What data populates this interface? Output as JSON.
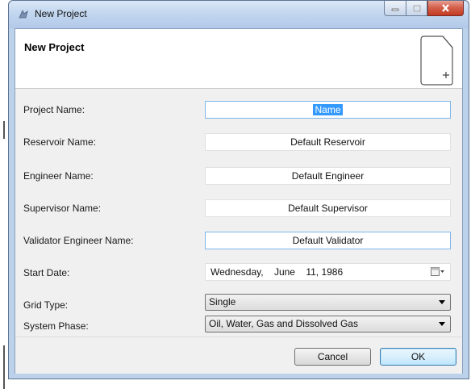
{
  "window": {
    "title": "New Project"
  },
  "header": {
    "title": "New Project"
  },
  "form": {
    "project_name": {
      "label": "Project Name:",
      "value": "Name"
    },
    "reservoir_name": {
      "label": "Reservoir Name:",
      "value": "Default Reservoir"
    },
    "engineer_name": {
      "label": "Engineer Name:",
      "value": "Default Engineer"
    },
    "supervisor_name": {
      "label": "Supervisor Name:",
      "value": "Default Supervisor"
    },
    "validator_name": {
      "label": "Validator Engineer Name:",
      "value": "Default Validator"
    },
    "start_date": {
      "label": "Start Date:",
      "weekday": "Wednesday,",
      "month": "June",
      "day_year": "11, 1986"
    },
    "grid_type": {
      "label": "Grid Type:",
      "value": "Single"
    },
    "system_phase": {
      "label": "System Phase:",
      "value": "Oil, Water, Gas and Dissolved Gas"
    }
  },
  "buttons": {
    "cancel": "Cancel",
    "ok": "OK"
  },
  "colors": {
    "selection": "#3399ff",
    "focus_border": "#7eb4ea",
    "close_button": "#c23a22"
  }
}
